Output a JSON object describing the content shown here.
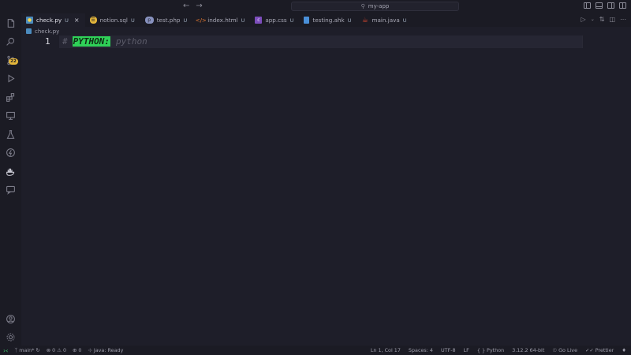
{
  "titlebar": {
    "search_text": "my-app",
    "back_icon": "arrow-left-icon",
    "forward_icon": "arrow-right-icon"
  },
  "activitybar": {
    "items": [
      {
        "name": "explorer",
        "icon": "files-icon"
      },
      {
        "name": "search",
        "icon": "search-icon"
      },
      {
        "name": "source-control",
        "icon": "source-control-icon",
        "badge": "22"
      },
      {
        "name": "run-debug",
        "icon": "run-debug-icon"
      },
      {
        "name": "extensions",
        "icon": "extensions-icon"
      },
      {
        "name": "remote-explorer",
        "icon": "remote-explorer-icon"
      },
      {
        "name": "testing",
        "icon": "flask-icon"
      },
      {
        "name": "thunder-client",
        "icon": "lightning-icon"
      },
      {
        "name": "docker",
        "icon": "whale-icon"
      },
      {
        "name": "chat",
        "icon": "chat-icon"
      }
    ],
    "bottom": [
      {
        "name": "accounts",
        "icon": "account-icon"
      },
      {
        "name": "manage",
        "icon": "gear-icon"
      }
    ]
  },
  "tabs": [
    {
      "label": "check.py",
      "status": "U",
      "icon_color": "#4b8bbe",
      "active": true
    },
    {
      "label": "notion.sql",
      "status": "U",
      "icon_color": "#e5b73b"
    },
    {
      "label": "test.php",
      "status": "U",
      "icon_color": "#8892bf"
    },
    {
      "label": "index.html",
      "status": "U",
      "icon_color": "#e37933"
    },
    {
      "label": "app.css",
      "status": "U",
      "icon_color": "#7c4dbb"
    },
    {
      "label": "testing.ahk",
      "status": "U",
      "icon_color": "#4a90d9"
    },
    {
      "label": "main.java",
      "status": "U",
      "icon_color": "#d0452f"
    }
  ],
  "breadcrumb": {
    "file": "check.py"
  },
  "editor": {
    "line_number": "1",
    "hash": "#",
    "tag": "PYTHON:",
    "comment": "python",
    "tag_color": "#2fd158"
  },
  "statusbar": {
    "branch": "main*",
    "errors": "0",
    "warnings": "0",
    "ports": "0",
    "java": "Java: Ready",
    "position": "Ln 1, Col 17",
    "spaces": "Spaces: 4",
    "encoding": "UTF-8",
    "eol": "LF",
    "language": "Python",
    "interpreter": "3.12.2 64-bit",
    "go_live": "Go Live",
    "prettier": "Prettier"
  }
}
